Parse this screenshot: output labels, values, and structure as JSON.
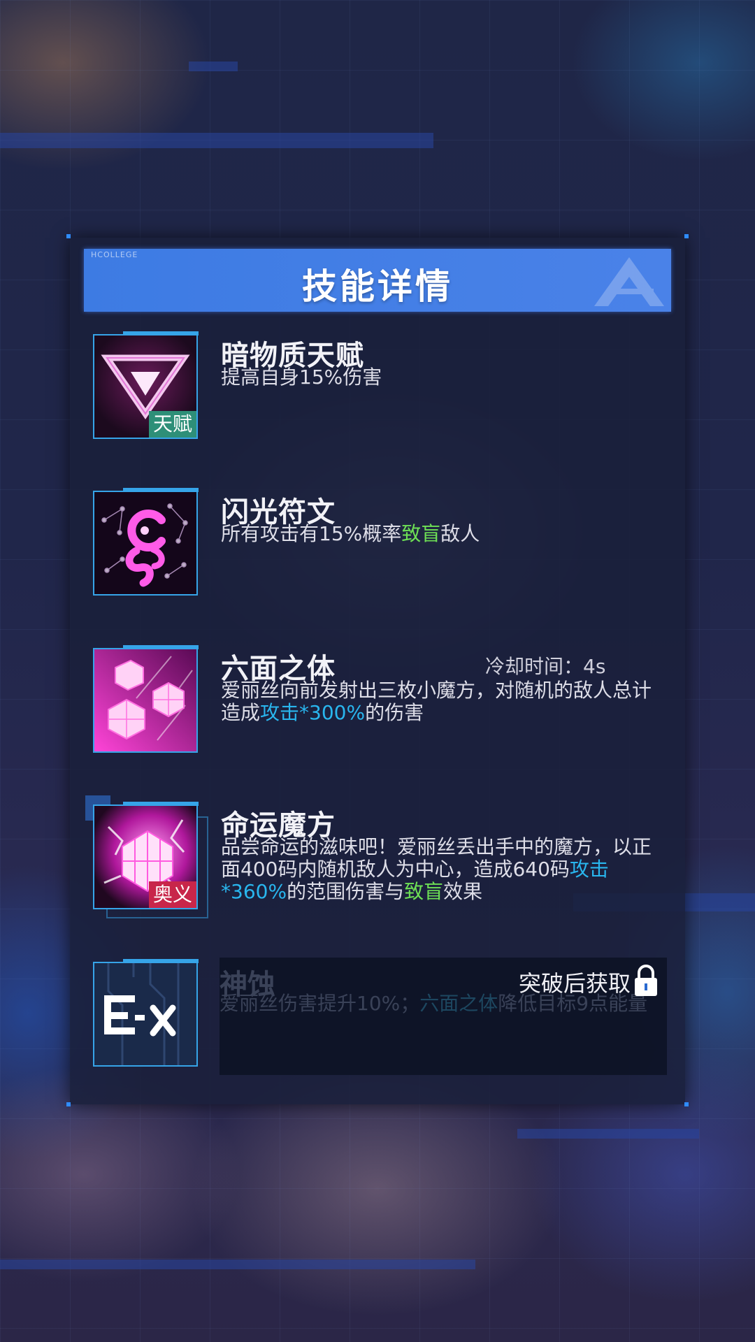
{
  "header": {
    "tag": "HCOLLEGE",
    "title": "技能详情"
  },
  "skills": [
    {
      "name": "暗物质天赋",
      "badge": "天赋",
      "desc": "提高自身15%伤害"
    },
    {
      "name": "闪光符文",
      "desc_pre": "所有攻击有15%概率",
      "desc_hl": "致盲",
      "desc_post": "敌人"
    },
    {
      "name": "六面之体",
      "cooldown": "冷却时间：4s",
      "desc_pre": "爱丽丝向前发射出三枚小魔方，对随机的敌人总计造成",
      "desc_hl": "攻击*300%",
      "desc_post": "的伤害"
    },
    {
      "name": "命运魔方",
      "badge": "奥义",
      "desc_pre": "品尝命运的滋味吧！爱丽丝丢出手中的魔方，以正面400码内随机敌人为中心，造成640码",
      "desc_hl1": "攻击*360%",
      "desc_mid": "的范围伤害与",
      "desc_hl2": "致盲",
      "desc_post": "效果"
    },
    {
      "name": "神蚀",
      "unlock": "突破后获取",
      "desc_pre": "爱丽丝伤害提升10%；",
      "desc_hl": "六面之体",
      "desc_post": "降低目标9点能量"
    }
  ],
  "colors": {
    "accent": "#3d7be3",
    "green": "#6ee055",
    "blue": "#29b6ee",
    "talent_badge": "#2e8f78",
    "ult_badge": "#c8264a"
  }
}
